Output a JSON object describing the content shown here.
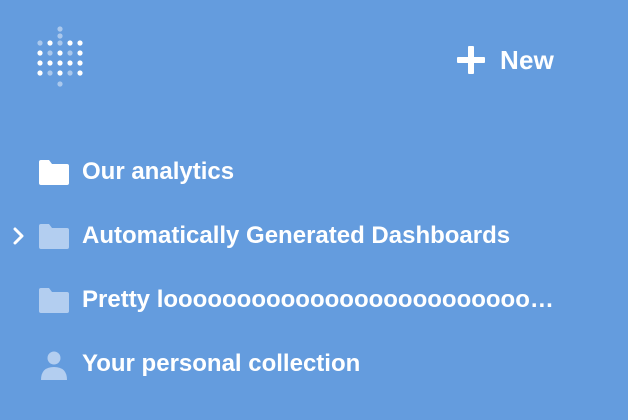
{
  "header": {
    "new_button_label": "New"
  },
  "collections": [
    {
      "label": "Our analytics",
      "icon": "folder-icon",
      "expandable": false,
      "dimmed": false
    },
    {
      "label": "Automatically Generated Dashboards",
      "icon": "folder-icon",
      "expandable": true,
      "dimmed": true
    },
    {
      "label": "Pretty looooooooooooooooooooooooooong …",
      "icon": "folder-icon",
      "expandable": false,
      "dimmed": true
    },
    {
      "label": "Your personal collection",
      "icon": "person-icon",
      "expandable": false,
      "dimmed": true
    }
  ],
  "colors": {
    "background": "#649cde",
    "text": "#ffffff",
    "icon_solid": "#ffffff",
    "icon_dimmed": "#b3cef0"
  }
}
